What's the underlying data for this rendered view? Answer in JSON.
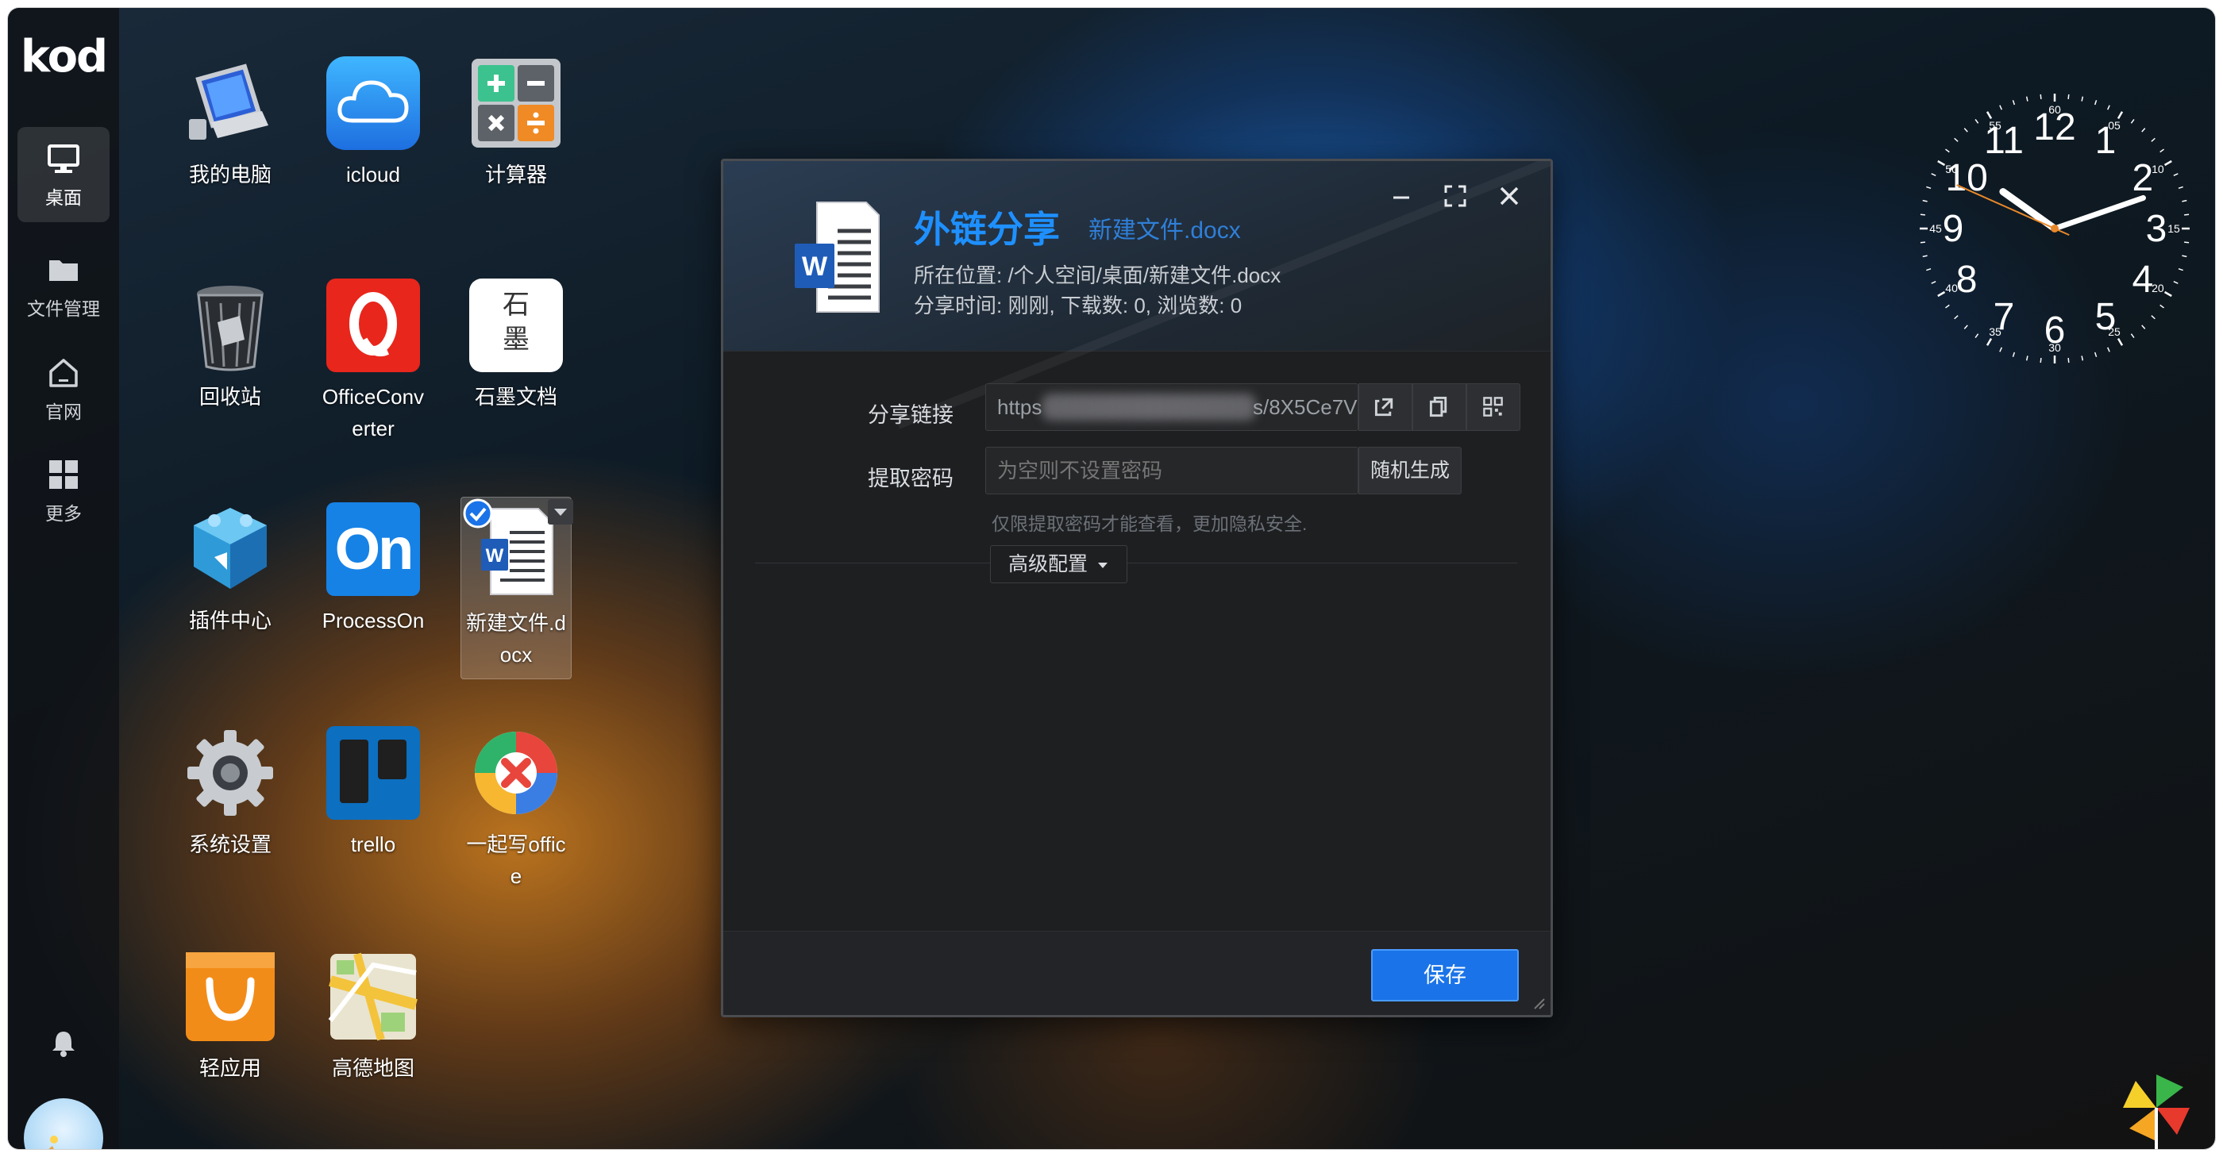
{
  "sidebar": {
    "logo": "kod",
    "items": [
      {
        "label": "桌面",
        "icon": "monitor-icon",
        "active": true
      },
      {
        "label": "文件管理",
        "icon": "folder-icon",
        "active": false
      },
      {
        "label": "官网",
        "icon": "home-icon",
        "active": false
      },
      {
        "label": "更多",
        "icon": "grid-icon",
        "active": false
      }
    ],
    "bell_icon": "bell-icon"
  },
  "desktop": {
    "icons": [
      {
        "label": "我的电脑",
        "icon": "computer-icon"
      },
      {
        "label": "icloud",
        "icon": "icloud-icon"
      },
      {
        "label": "计算器",
        "icon": "calculator-icon"
      },
      {
        "label": "回收站",
        "icon": "recycle-bin-icon"
      },
      {
        "label": "OfficeConverter",
        "icon": "office-converter-icon"
      },
      {
        "label": "石墨文档",
        "icon": "shimo-docs-icon",
        "tile_text": "石\n墨"
      },
      {
        "label": "插件中心",
        "icon": "plugin-center-icon"
      },
      {
        "label": "ProcessOn",
        "icon": "processon-icon",
        "tile_text": "On"
      },
      {
        "label": "新建文件.docx",
        "icon": "word-document-icon",
        "selected": true
      },
      {
        "label": "系统设置",
        "icon": "settings-gear-icon"
      },
      {
        "label": "trello",
        "icon": "trello-icon"
      },
      {
        "label": "一起写office",
        "icon": "yiqixie-office-icon"
      },
      {
        "label": "轻应用",
        "icon": "shopping-bag-icon"
      },
      {
        "label": "高德地图",
        "icon": "map-icon"
      }
    ]
  },
  "dialog": {
    "title": "外链分享",
    "subtitle": "新建文件.docx",
    "location": "所在位置: /个人空间/桌面/新建文件.docx",
    "stats": "分享时间: 刚刚, 下载数: 0, 浏览数: 0",
    "share_link_label": "分享链接",
    "share_link_prefix": "https",
    "share_link_suffix": "s/8X5Ce7V",
    "password_label": "提取密码",
    "password_placeholder": "为空则不设置密码",
    "random_button": "随机生成",
    "hint": "仅限提取密码才能查看，更加隐私安全.",
    "advanced_button": "高级配置",
    "save_button": "保存"
  },
  "clock": {
    "hour_numbers": [
      "12",
      "1",
      "2",
      "3",
      "4",
      "5",
      "6",
      "7",
      "8",
      "9",
      "10",
      "11"
    ],
    "minute_numbers": [
      "60",
      "05",
      "10",
      "15",
      "20",
      "25",
      "30",
      "35",
      "40",
      "45",
      "50",
      "55"
    ],
    "time": "10:11:49"
  }
}
